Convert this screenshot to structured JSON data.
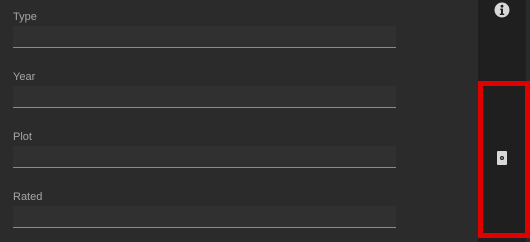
{
  "form": {
    "fields": [
      {
        "label": "Type",
        "value": ""
      },
      {
        "label": "Year",
        "value": ""
      },
      {
        "label": "Plot",
        "value": ""
      },
      {
        "label": "Rated",
        "value": ""
      }
    ]
  },
  "side_rail": {
    "info_icon": "info-circle-icon",
    "detail_icon": "document-icon",
    "highlight_color": "#e00000"
  }
}
